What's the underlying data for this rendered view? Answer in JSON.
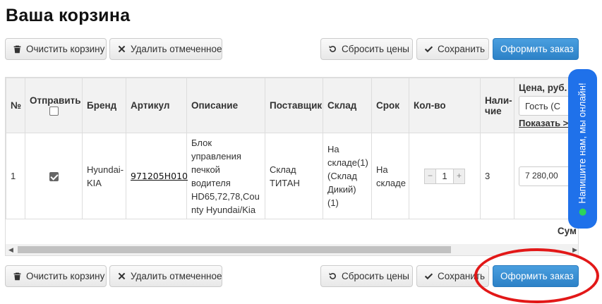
{
  "page": {
    "title": "Ваша корзина"
  },
  "toolbar": {
    "clear_cart": "Очистить корзину",
    "delete_marked": "Удалить отмеченное",
    "reset_prices": "Сбросить цены",
    "save": "Сохранить",
    "checkout": "Оформить заказ"
  },
  "table": {
    "headers": {
      "num": "№",
      "send": "Отправить",
      "brand": "Бренд",
      "article": "Артикул",
      "description": "Описание",
      "supplier": "Поставщик",
      "warehouse": "Склад",
      "term": "Срок",
      "qty": "Кол-во",
      "stock": "Нали-\nчие",
      "price": "Цена, руб.",
      "price_select": "Гость (С",
      "price_show": "Показать >"
    },
    "row": {
      "num": "1",
      "brand": "Hyundai-\nKIA",
      "article": "971205H010",
      "description": "Блок\nуправления\nпечкой\nводителя\nHD65,72,78,Cou\nnty Hyundai/Kia",
      "supplier": "Склад\nТИТАН",
      "warehouse": "На\nскладе(1)\n(Склад\nДикий)(1)",
      "term": "На\nскладе",
      "qty": "1",
      "stock": "3",
      "price": "7 280,00"
    },
    "sum_label": "Сум"
  },
  "chat": {
    "label": "Напишите нам, мы онлайн!"
  },
  "colors": {
    "primary": "#3a8fd6",
    "chat": "#1f71ea",
    "highlight": "#e21818",
    "online": "#2dd45a"
  }
}
